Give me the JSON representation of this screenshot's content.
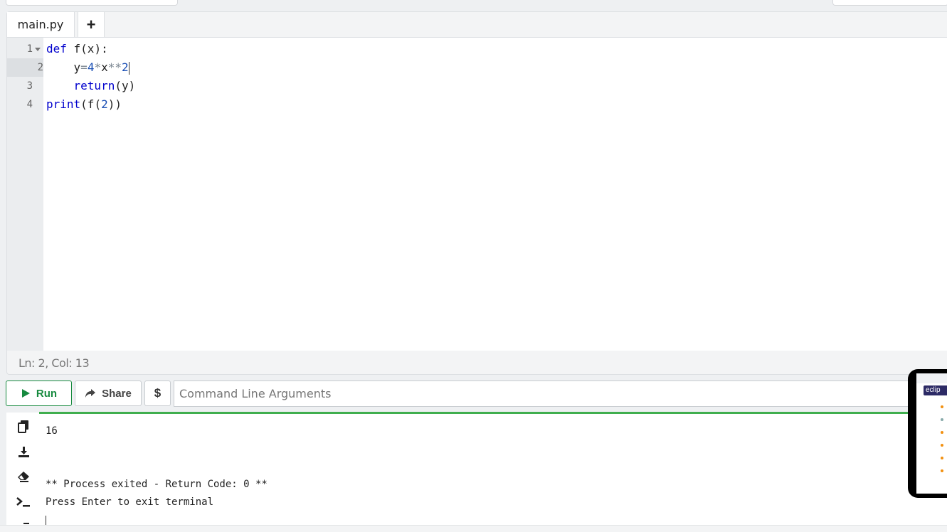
{
  "editor": {
    "tab_label": "main.py",
    "add_tab_label": "+",
    "lines": [
      {
        "number": "1",
        "text": "def f(x):"
      },
      {
        "number": "2",
        "text": "    y=4*x**2"
      },
      {
        "number": "3",
        "text": "    return(y)"
      },
      {
        "number": "4",
        "text": "print(f(2))"
      }
    ],
    "status": "Ln: 2,  Col: 13"
  },
  "toolbar": {
    "run_label": "Run",
    "share_label": "Share",
    "dollar_label": "$",
    "cmd_placeholder": "Command Line Arguments"
  },
  "terminal": {
    "output_value": "16",
    "exit_message": "** Process exited - Return Code: 0 **",
    "prompt_message": "Press Enter to exit terminal"
  },
  "overlay": {
    "logo_text": "eclip"
  },
  "icons": {
    "copy": "copy-icon",
    "download": "download-icon",
    "clear": "eraser-icon",
    "terminal": "terminal-icon",
    "run": "play-icon",
    "share": "share-arrow-icon"
  },
  "colors": {
    "run_green": "#178a3f",
    "terminal_accent": "#3fae4e",
    "keyword": "#0000cd"
  }
}
